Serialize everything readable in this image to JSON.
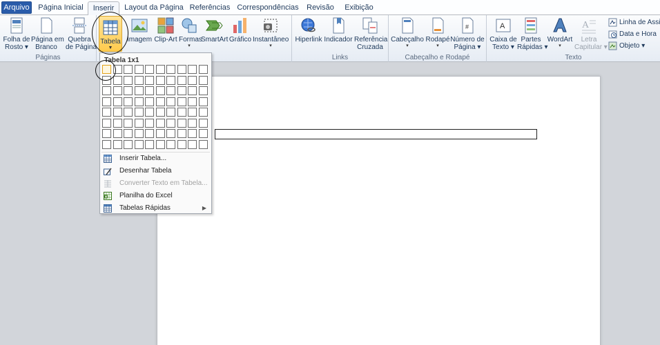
{
  "tabs": [
    {
      "label": "Arquivo"
    },
    {
      "label": "Página Inicial"
    },
    {
      "label": "Inserir"
    },
    {
      "label": "Layout da Página"
    },
    {
      "label": "Referências"
    },
    {
      "label": "Correspondências"
    },
    {
      "label": "Revisão"
    },
    {
      "label": "Exibição"
    }
  ],
  "ribbon": {
    "paginas": {
      "label": "Páginas",
      "folha_rosto": [
        "Folha de",
        "Rosto"
      ],
      "pagina_branco": [
        "Página em",
        "Branco"
      ],
      "quebra_pagina": [
        "Quebra",
        "de Página"
      ]
    },
    "tabela": {
      "label": "Tabela"
    },
    "ilustracoes": {
      "label": "ações",
      "imagem": "Imagem",
      "clipart": "Clip-Art",
      "formas": "Formas",
      "smartart": "SmartArt",
      "grafico": "Gráfico",
      "instantaneo": "Instantâneo"
    },
    "links": {
      "label": "Links",
      "hiperlink": "Hiperlink",
      "indicador": "Indicador",
      "referencia": [
        "Referência",
        "Cruzada"
      ]
    },
    "cabecalho_rodape": {
      "label": "Cabeçalho e Rodapé",
      "cabecalho": "Cabeçalho",
      "rodape": "Rodapé",
      "numero_pagina": [
        "Número de",
        "Página"
      ]
    },
    "texto": {
      "label": "Texto",
      "caixa_texto": [
        "Caixa de",
        "Texto"
      ],
      "partes_rapidas": [
        "Partes",
        "Rápidas"
      ],
      "wordart": "WordArt",
      "letra_capitular": [
        "Letra",
        "Capitular"
      ],
      "linha_assinatura": "Linha de Assin",
      "data_hora": "Data e Hora",
      "objeto": "Objeto"
    }
  },
  "dropdown": {
    "title": "Tabela 1x1",
    "menu": [
      {
        "label": "Inserir Tabela...",
        "icon": "insert-table-icon"
      },
      {
        "label": "Desenhar Tabela",
        "icon": "draw-table-icon"
      },
      {
        "label": "Converter Texto em Tabela...",
        "icon": "convert-text-icon"
      },
      {
        "label": "Planilha do Excel",
        "icon": "excel-icon"
      },
      {
        "label": "Tabelas Rápidas",
        "icon": "quick-tables-icon"
      }
    ]
  },
  "colors": {
    "file_tab": "#2a5caa",
    "highlight": "#ffcb4d",
    "ribbon_text": "#1e395b"
  }
}
